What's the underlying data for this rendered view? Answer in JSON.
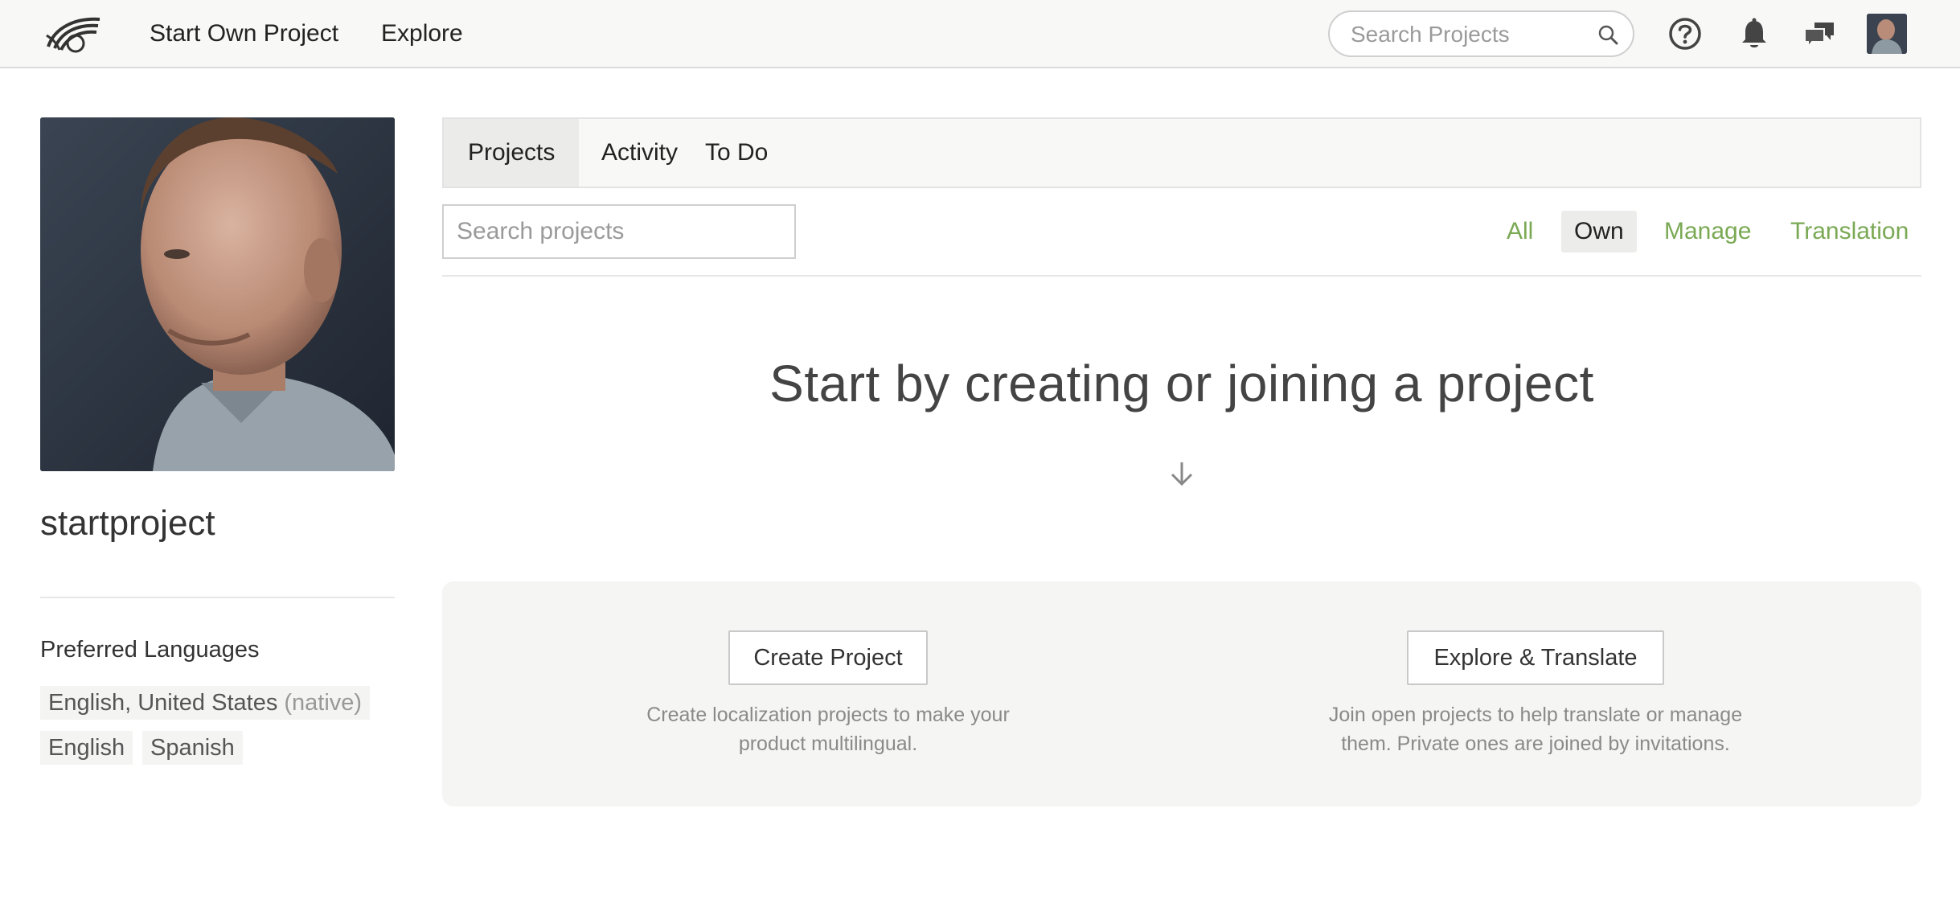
{
  "topnav": {
    "start_own_project": "Start Own Project",
    "explore": "Explore",
    "search_placeholder": "Search Projects"
  },
  "icons": {
    "logo": "logo-icon",
    "search": "search-icon",
    "help": "question-circle-icon",
    "notifications": "bell-icon",
    "messages": "chat-bubbles-icon",
    "avatar": "user-avatar"
  },
  "profile": {
    "username": "startproject",
    "preferred_languages_title": "Preferred Languages",
    "languages": [
      {
        "name": "English, United States",
        "note": "(native)"
      },
      {
        "name": "English",
        "note": ""
      },
      {
        "name": "Spanish",
        "note": ""
      }
    ]
  },
  "tabs": [
    {
      "label": "Projects",
      "active": true
    },
    {
      "label": "Activity",
      "active": false
    },
    {
      "label": "To Do",
      "active": false
    }
  ],
  "projects": {
    "search_placeholder": "Search projects",
    "filters": [
      {
        "label": "All",
        "active": false
      },
      {
        "label": "Own",
        "active": true
      },
      {
        "label": "Manage",
        "active": false
      },
      {
        "label": "Translation",
        "active": false
      }
    ],
    "empty_heading": "Start by creating or joining a project"
  },
  "cta": {
    "create": {
      "button": "Create Project",
      "description": "Create localization projects to make your product multilingual."
    },
    "explore": {
      "button": "Explore & Translate",
      "description": "Join open projects to help translate or manage them. Private ones are joined by invitations."
    }
  },
  "colors": {
    "accent_green": "#7aa954",
    "topbar_bg": "#f8f8f7",
    "panel_bg": "#f5f5f4"
  }
}
